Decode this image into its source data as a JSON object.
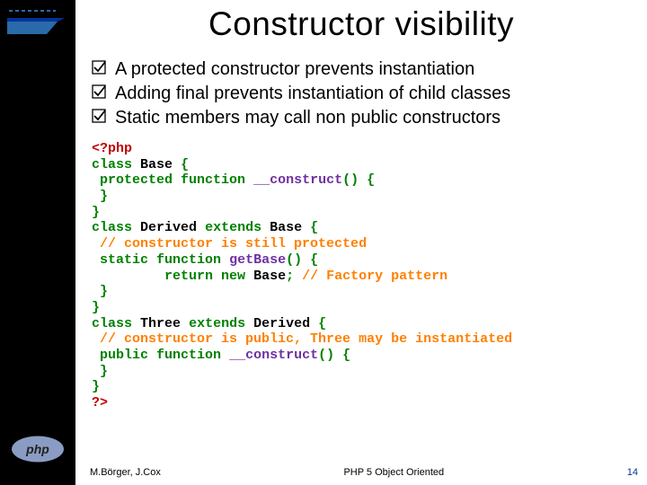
{
  "title": "Constructor visibility",
  "bullets": [
    "A protected constructor prevents instantiation",
    "Adding final prevents instantiation of child classes",
    "Static members may call non public constructors"
  ],
  "code": {
    "opentag": "<?php",
    "kw_class": "class",
    "id_base": "Base",
    "kw_protected": "protected",
    "kw_function": "function",
    "fn_construct": "__construct",
    "parens": "()",
    "brace_l": "{",
    "brace_r": "}",
    "id_derived": "Derived",
    "kw_extends": "extends",
    "com_still": "// constructor is still protected",
    "kw_static": "static",
    "fn_getbase": "getBase",
    "kw_return": "return",
    "kw_new": "new",
    "semi": ";",
    "com_factory": "// Factory pattern",
    "id_three": "Three",
    "com_public": "// constructor is public, Three may be instantiated",
    "kw_public": "public",
    "closetag": "?>"
  },
  "footer": {
    "authors": "M.Börger, J.Cox",
    "center": "PHP 5 Object Oriented",
    "page": "14"
  },
  "colors": {
    "blue": "#003399",
    "hull": "#2a6aa8"
  }
}
